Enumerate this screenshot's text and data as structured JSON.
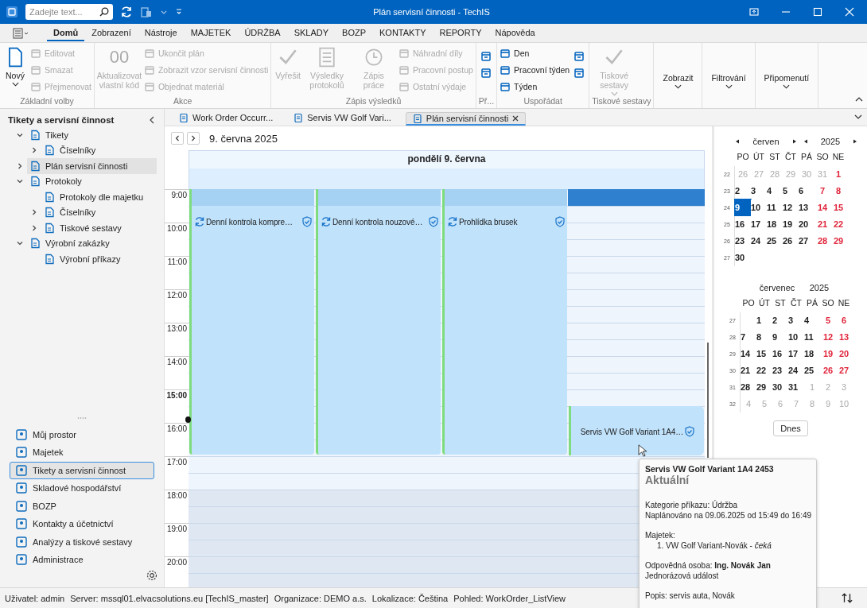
{
  "window": {
    "title": "Plán servisní činnosti - TechIS",
    "search_placeholder": "Zadejte text..."
  },
  "menu_tabs": [
    {
      "label": "Domů",
      "selected": true
    },
    {
      "label": "Zobrazení",
      "selected": false
    },
    {
      "label": "Nástroje",
      "selected": false
    },
    {
      "label": "MAJETEK",
      "selected": false
    },
    {
      "label": "ÚDRŽBA",
      "selected": false
    },
    {
      "label": "SKLADY",
      "selected": false
    },
    {
      "label": "BOZP",
      "selected": false
    },
    {
      "label": "KONTAKTY",
      "selected": false
    },
    {
      "label": "REPORTY",
      "selected": false
    },
    {
      "label": "Nápověda",
      "selected": false
    }
  ],
  "ribbon": [
    {
      "label": "Základní volby",
      "items": [
        {
          "kind": "large",
          "label": "Nový",
          "caret": true,
          "disabled": false
        },
        {
          "kind": "small",
          "label": "Editovat",
          "disabled": true
        },
        {
          "kind": "small",
          "label": "Smazat",
          "disabled": true
        },
        {
          "kind": "small",
          "label": "Přejmenovat",
          "disabled": true
        }
      ]
    },
    {
      "label": "Akce",
      "items": [
        {
          "kind": "large",
          "label": "Aktualizovat vlastní kód",
          "glyph": "00",
          "caret": false,
          "disabled": true
        },
        {
          "kind": "small",
          "label": "Ukončit plán",
          "disabled": true
        },
        {
          "kind": "small",
          "label": "Zobrazit vzor servisní činnosti",
          "disabled": true
        },
        {
          "kind": "small",
          "label": "Objednat materiál",
          "disabled": true
        }
      ]
    },
    {
      "label": "Zápis výsledků",
      "items": [
        {
          "kind": "large",
          "label": "Vyřešit",
          "caret": false,
          "disabled": true
        },
        {
          "kind": "large",
          "label": "Výsledky protokolů",
          "caret": false,
          "disabled": true
        },
        {
          "kind": "large",
          "label": "Zápis práce",
          "caret": false,
          "disabled": true
        },
        {
          "kind": "small",
          "label": "Náhradní díly",
          "disabled": true
        },
        {
          "kind": "small",
          "label": "Pracovní postup",
          "disabled": true
        },
        {
          "kind": "small",
          "label": "Ostatní výdaje",
          "disabled": true
        }
      ]
    },
    {
      "label": "Př...",
      "items": [
        {
          "kind": "icon",
          "disabled": false
        },
        {
          "kind": "icon",
          "disabled": false
        }
      ]
    },
    {
      "label": "Uspořádat",
      "items": [
        {
          "kind": "small",
          "label": "Den",
          "disabled": false
        },
        {
          "kind": "small",
          "label": "Pracovní týden",
          "disabled": false
        },
        {
          "kind": "small",
          "label": "Týden",
          "disabled": false
        },
        {
          "kind": "icon",
          "disabled": false
        },
        {
          "kind": "icon",
          "disabled": false
        }
      ]
    },
    {
      "label": "Tiskové sestavy",
      "items": [
        {
          "kind": "large",
          "label": "Tiskové sestavy",
          "caret": true,
          "disabled": true
        }
      ]
    },
    {
      "items": [
        {
          "kind": "dropdown",
          "label": "Zobrazit",
          "disabled": false
        }
      ]
    },
    {
      "items": [
        {
          "kind": "dropdown",
          "label": "Filtrování",
          "disabled": false
        }
      ]
    },
    {
      "items": [
        {
          "kind": "dropdown",
          "label": "Připomenutí",
          "disabled": false
        }
      ]
    }
  ],
  "sidebar": {
    "title": "Tikety a servisní činnost",
    "tree": [
      {
        "label": "Tikety",
        "expanded": true,
        "selected": false,
        "children": [
          {
            "label": "Číselníky",
            "expanded": false,
            "selected": false
          }
        ]
      },
      {
        "label": "Plán servisní činnosti",
        "expanded": false,
        "selected": true
      },
      {
        "label": "Protokoly",
        "expanded": true,
        "selected": false,
        "children": [
          {
            "label": "Protokoly dle majetku",
            "selected": false
          },
          {
            "label": "Číselníky",
            "expanded": false,
            "selected": false
          },
          {
            "label": "Tiskové sestavy",
            "expanded": false,
            "selected": false
          }
        ]
      },
      {
        "label": "Výrobní zakázky",
        "expanded": true,
        "selected": false,
        "children": [
          {
            "label": "Výrobní příkazy",
            "selected": false
          }
        ]
      }
    ],
    "nav": [
      {
        "label": "Můj prostor",
        "selected": false
      },
      {
        "label": "Majetek",
        "selected": false
      },
      {
        "label": "Tikety a servisní činnost",
        "selected": true
      },
      {
        "label": "Skladové hospodářství",
        "selected": false
      },
      {
        "label": "BOZP",
        "selected": false
      },
      {
        "label": "Kontakty a účetnictví",
        "selected": false
      },
      {
        "label": "Analýzy a tiskové sestavy",
        "selected": false
      },
      {
        "label": "Administrace",
        "selected": false
      }
    ]
  },
  "doc_tabs": [
    {
      "label": "Work Order Occurr...",
      "selected": false
    },
    {
      "label": "Servis VW Golf Vari...",
      "selected": false
    },
    {
      "label": "Plán servisní činnosti",
      "selected": true
    }
  ],
  "calendar": {
    "date_label": "9. června 2025",
    "day_header": "pondělí 9. června",
    "work_hours": [
      {
        "label": "9:00",
        "current": false
      },
      {
        "label": "10:00",
        "current": false
      },
      {
        "label": "11:00",
        "current": false
      },
      {
        "label": "12:00",
        "current": false
      },
      {
        "label": "13:00",
        "current": false
      },
      {
        "label": "14:00",
        "current": false
      },
      {
        "label": "15:00",
        "current": true
      },
      {
        "label": "16:00",
        "current": false
      },
      {
        "label": "17:00",
        "current": false
      }
    ],
    "off_hours": [
      {
        "label": "18:00",
        "current": false
      },
      {
        "label": "19:00",
        "current": false
      },
      {
        "label": "20:00",
        "current": false
      }
    ],
    "columns": [
      {
        "selected": false,
        "events": [
          {
            "kind": "recurring",
            "title": "Denní kontrola kompre…"
          }
        ]
      },
      {
        "selected": false,
        "events": [
          {
            "kind": "recurring",
            "title": "Denní kontrola nouzové…"
          }
        ]
      },
      {
        "selected": false,
        "events": [
          {
            "kind": "recurring",
            "title": "Prohlídka brusek"
          }
        ]
      },
      {
        "selected": true,
        "events": [
          {
            "kind": "single",
            "title": "Servis VW Golf Variant 1A4…"
          }
        ]
      }
    ]
  },
  "mini_calendar": {
    "months": [
      {
        "month": "červen",
        "year": "2025",
        "nav": true,
        "weekdays": [
          "PO",
          "ÚT",
          "ST",
          "ČT",
          "PÁ",
          "SO",
          "NE"
        ],
        "weeks": [
          {
            "week": "22",
            "days": [
              {
                "d": "26",
                "kind": "other",
                "selected": false
              },
              {
                "d": "27",
                "kind": "other",
                "selected": false
              },
              {
                "d": "28",
                "kind": "other",
                "selected": false
              },
              {
                "d": "29",
                "kind": "other",
                "selected": false
              },
              {
                "d": "30",
                "kind": "other",
                "selected": false
              },
              {
                "d": "31",
                "kind": "other",
                "selected": false
              },
              {
                "d": "1",
                "kind": "weekend",
                "selected": false
              }
            ]
          },
          {
            "week": "23",
            "days": [
              {
                "d": "2",
                "kind": "work",
                "selected": false
              },
              {
                "d": "3",
                "kind": "work",
                "selected": false
              },
              {
                "d": "4",
                "kind": "work",
                "selected": false
              },
              {
                "d": "5",
                "kind": "work",
                "selected": false
              },
              {
                "d": "6",
                "kind": "work",
                "selected": false
              },
              {
                "d": "7",
                "kind": "weekend",
                "selected": false
              },
              {
                "d": "8",
                "kind": "weekend",
                "selected": false
              }
            ]
          },
          {
            "week": "24",
            "days": [
              {
                "d": "9",
                "kind": "work",
                "selected": true
              },
              {
                "d": "10",
                "kind": "work",
                "selected": false
              },
              {
                "d": "11",
                "kind": "work",
                "selected": false
              },
              {
                "d": "12",
                "kind": "work",
                "selected": false
              },
              {
                "d": "13",
                "kind": "work",
                "selected": false
              },
              {
                "d": "14",
                "kind": "weekend",
                "selected": false
              },
              {
                "d": "15",
                "kind": "weekend",
                "selected": false
              }
            ]
          },
          {
            "week": "25",
            "days": [
              {
                "d": "16",
                "kind": "work",
                "selected": false
              },
              {
                "d": "17",
                "kind": "work",
                "selected": false
              },
              {
                "d": "18",
                "kind": "work",
                "selected": false
              },
              {
                "d": "19",
                "kind": "work",
                "selected": false
              },
              {
                "d": "20",
                "kind": "work",
                "selected": false
              },
              {
                "d": "21",
                "kind": "weekend",
                "selected": false
              },
              {
                "d": "22",
                "kind": "weekend",
                "selected": false
              }
            ]
          },
          {
            "week": "26",
            "days": [
              {
                "d": "23",
                "kind": "work",
                "selected": false
              },
              {
                "d": "24",
                "kind": "work",
                "selected": false
              },
              {
                "d": "25",
                "kind": "work",
                "selected": false
              },
              {
                "d": "26",
                "kind": "work",
                "selected": false
              },
              {
                "d": "27",
                "kind": "work",
                "selected": false
              },
              {
                "d": "28",
                "kind": "weekend",
                "selected": false
              },
              {
                "d": "29",
                "kind": "weekend",
                "selected": false
              }
            ]
          },
          {
            "week": "27",
            "days": [
              {
                "d": "30",
                "kind": "work",
                "selected": false
              }
            ]
          }
        ]
      },
      {
        "month": "červenec",
        "year": "2025",
        "nav": false,
        "weekdays": [
          "PO",
          "ÚT",
          "ST",
          "ČT",
          "PÁ",
          "SO",
          "NE"
        ],
        "weeks": [
          {
            "week": "27",
            "days": [
              {
                "kind": "empty"
              },
              {
                "d": "1",
                "kind": "work",
                "selected": false
              },
              {
                "d": "2",
                "kind": "work",
                "selected": false
              },
              {
                "d": "3",
                "kind": "work",
                "selected": false
              },
              {
                "d": "4",
                "kind": "work",
                "selected": false
              },
              {
                "d": "5",
                "kind": "weekend",
                "selected": false
              },
              {
                "d": "6",
                "kind": "weekend",
                "selected": false
              }
            ]
          },
          {
            "week": "28",
            "days": [
              {
                "d": "7",
                "kind": "work",
                "selected": false
              },
              {
                "d": "8",
                "kind": "work",
                "selected": false
              },
              {
                "d": "9",
                "kind": "work",
                "selected": false
              },
              {
                "d": "10",
                "kind": "work",
                "selected": false
              },
              {
                "d": "11",
                "kind": "work",
                "selected": false
              },
              {
                "d": "12",
                "kind": "weekend",
                "selected": false
              },
              {
                "d": "13",
                "kind": "weekend",
                "selected": false
              }
            ]
          },
          {
            "week": "29",
            "days": [
              {
                "d": "14",
                "kind": "work",
                "selected": false
              },
              {
                "d": "15",
                "kind": "work",
                "selected": false
              },
              {
                "d": "16",
                "kind": "work",
                "selected": false
              },
              {
                "d": "17",
                "kind": "work",
                "selected": false
              },
              {
                "d": "18",
                "kind": "work",
                "selected": false
              },
              {
                "d": "19",
                "kind": "weekend",
                "selected": false
              },
              {
                "d": "20",
                "kind": "weekend",
                "selected": false
              }
            ]
          },
          {
            "week": "30",
            "days": [
              {
                "d": "21",
                "kind": "work",
                "selected": false
              },
              {
                "d": "22",
                "kind": "work",
                "selected": false
              },
              {
                "d": "23",
                "kind": "work",
                "selected": false
              },
              {
                "d": "24",
                "kind": "work",
                "selected": false
              },
              {
                "d": "25",
                "kind": "work",
                "selected": false
              },
              {
                "d": "26",
                "kind": "weekend",
                "selected": false
              },
              {
                "d": "27",
                "kind": "weekend",
                "selected": false
              }
            ]
          },
          {
            "week": "31",
            "days": [
              {
                "d": "28",
                "kind": "work",
                "selected": false
              },
              {
                "d": "29",
                "kind": "work",
                "selected": false
              },
              {
                "d": "30",
                "kind": "work",
                "selected": false
              },
              {
                "d": "31",
                "kind": "work",
                "selected": false
              },
              {
                "d": "1",
                "kind": "other",
                "selected": false
              },
              {
                "d": "2",
                "kind": "other",
                "selected": false
              },
              {
                "d": "3",
                "kind": "other",
                "selected": false
              }
            ]
          },
          {
            "week": "32",
            "days": [
              {
                "d": "4",
                "kind": "other",
                "selected": false
              },
              {
                "d": "5",
                "kind": "other",
                "selected": false
              },
              {
                "d": "6",
                "kind": "other",
                "selected": false
              },
              {
                "d": "7",
                "kind": "other",
                "selected": false
              },
              {
                "d": "8",
                "kind": "other",
                "selected": false
              },
              {
                "d": "9",
                "kind": "other",
                "selected": false
              },
              {
                "d": "10",
                "kind": "other",
                "selected": false
              }
            ]
          }
        ]
      }
    ],
    "today_button": "Dnes"
  },
  "tooltip": {
    "title": "Servis VW Golf Variant 1A4 2453",
    "status": "Aktuální",
    "blocks": [
      [
        {
          "kind": "plain",
          "text": "Kategorie příkazu: Údržba"
        },
        {
          "kind": "plain",
          "text": "Naplánováno na 09.06.2025 od 15:49 do 16:49"
        }
      ],
      [
        {
          "kind": "plain",
          "text": "Majetek:"
        },
        {
          "kind": "indent",
          "text": "1. VW Golf Variant-Novák - *čeká*"
        }
      ],
      [
        {
          "kind": "plain",
          "text": "Odpovědná osoba: **Ing. Novák Jan**"
        },
        {
          "kind": "plain",
          "text": "Jednorázová událost"
        }
      ],
      [
        {
          "kind": "plain",
          "text": "Popis: servis auta, Novák"
        }
      ]
    ]
  },
  "status_bar": [
    "Uživatel: admin",
    "Server: mssql01.elvacsolutions.eu [TechIS_master]",
    "Organizace: DEMO a.s.",
    "Lokalizace: Čeština",
    "Pohled: WorkOrder_ListView"
  ]
}
